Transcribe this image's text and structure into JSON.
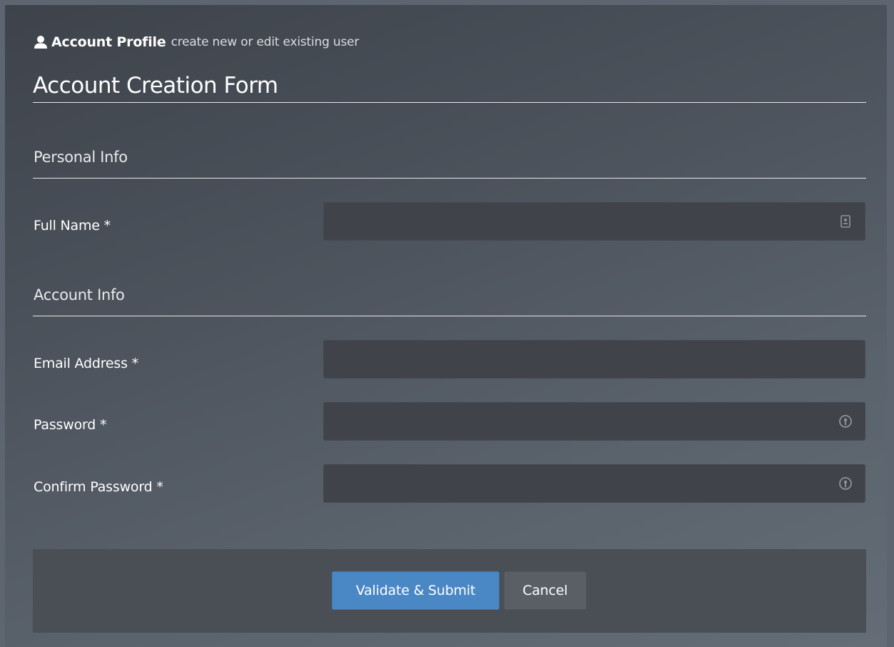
{
  "header": {
    "icon": "user-icon",
    "title": "Account Profile",
    "subtitle": "create new or edit existing user"
  },
  "form": {
    "title": "Account Creation Form"
  },
  "sections": {
    "personal": {
      "title": "Personal Info",
      "fields": {
        "full_name": {
          "label": "Full Name *",
          "value": "",
          "icon": "id-card-icon"
        }
      }
    },
    "account": {
      "title": "Account Info",
      "fields": {
        "email": {
          "label": "Email Address *",
          "value": ""
        },
        "password": {
          "label": "Password *",
          "value": "",
          "icon": "password-key-icon"
        },
        "confirm_password": {
          "label": "Confirm Password *",
          "value": "",
          "icon": "password-key-icon"
        }
      }
    }
  },
  "footer": {
    "submit_label": "Validate & Submit",
    "cancel_label": "Cancel"
  },
  "colors": {
    "primary_button": "#4a87c5",
    "cancel_button": "#5a5f66",
    "input_background": "#404349",
    "footer_background": "#4a4f56"
  }
}
